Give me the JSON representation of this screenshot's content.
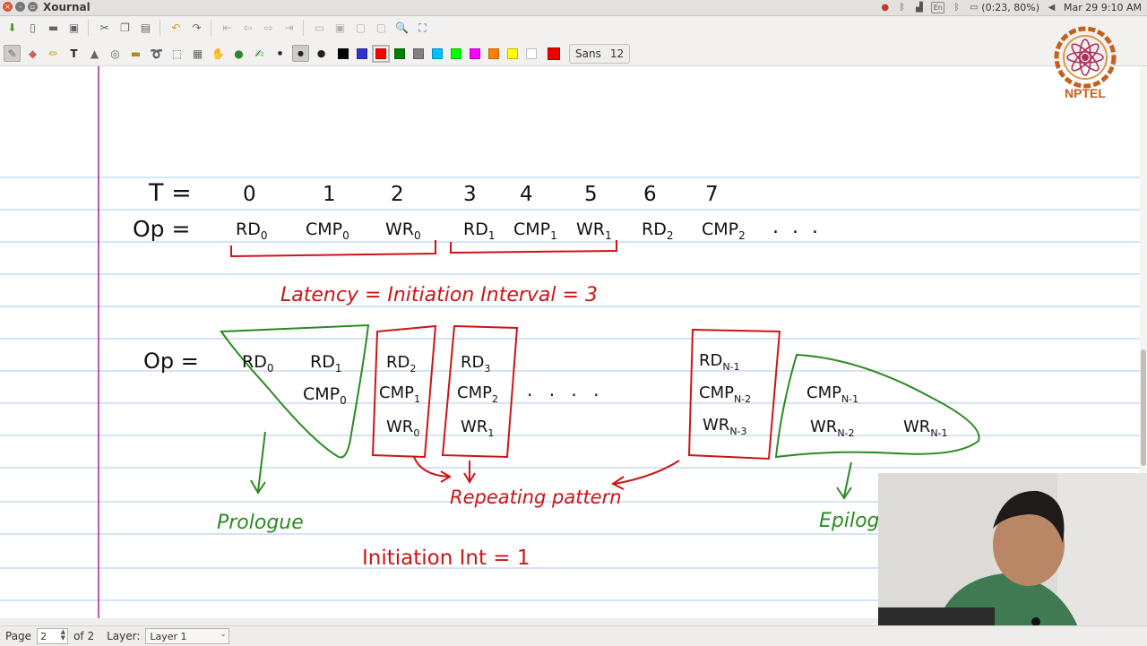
{
  "window": {
    "title": "Xournal",
    "tray": {
      "battery_status": "(0:23, 80%)",
      "datetime": "Mar 29  9:10 AM",
      "keyboard_layout": "En"
    }
  },
  "toolbar": {
    "font_name": "Sans",
    "font_size": "12",
    "colors": [
      "#000000",
      "#3333cc",
      "#ff0000",
      "#008000",
      "#808080",
      "#00c0ff",
      "#00ff00",
      "#ff00ff",
      "#ff8000",
      "#ffff00",
      "#ffffff"
    ],
    "current_color": "#ff0000"
  },
  "logo": {
    "text": "NPTEL"
  },
  "canvas": {
    "margin_color": "#a0148c",
    "rule_color": "#a8c8e8",
    "ink": {
      "black": "#111111",
      "red": "#cc1515",
      "green": "#2a8a22"
    },
    "time_label": "T =",
    "time_values": [
      "0",
      "1",
      "2",
      "3",
      "4",
      "5",
      "6",
      "7"
    ],
    "op_label": "Op =",
    "sequence": [
      {
        "base": "RD",
        "sub": "0"
      },
      {
        "base": "CMP",
        "sub": "0"
      },
      {
        "base": "WR",
        "sub": "0"
      },
      {
        "base": "RD",
        "sub": "1"
      },
      {
        "base": "CMP",
        "sub": "1"
      },
      {
        "base": "WR",
        "sub": "1"
      },
      {
        "base": "RD",
        "sub": "2"
      },
      {
        "base": "CMP",
        "sub": "2"
      }
    ],
    "ellipsis": ". . .",
    "latency_note": "Latency = Initiation Interval = 3",
    "pipeline_label": "Op =",
    "prologue_cells": [
      {
        "base": "RD",
        "sub": "0"
      },
      {
        "base": "RD",
        "sub": "1"
      },
      {
        "base": "CMP",
        "sub": "0"
      }
    ],
    "repeat_box_1": [
      {
        "base": "RD",
        "sub": "2"
      },
      {
        "base": "CMP",
        "sub": "1"
      },
      {
        "base": "WR",
        "sub": "0"
      }
    ],
    "repeat_box_2": [
      {
        "base": "RD",
        "sub": "3"
      },
      {
        "base": "CMP",
        "sub": "2"
      },
      {
        "base": "WR",
        "sub": "1"
      }
    ],
    "dots_middle": ".   .   .   .",
    "repeat_box_last": [
      {
        "base": "RD",
        "sub": "N-1"
      },
      {
        "base": "CMP",
        "sub": "N-2"
      },
      {
        "base": "WR",
        "sub": "N-3"
      }
    ],
    "epilogue_cells": [
      {
        "base": "CMP",
        "sub": "N-1"
      },
      {
        "base": "WR",
        "sub": "N-2"
      },
      {
        "base": "WR",
        "sub": "N-1"
      }
    ],
    "prologue_label": "Prologue",
    "repeating_label": "Repeating pattern",
    "epilogue_label": "Epilog",
    "initiation_int_note": "Initiation Int = 1"
  },
  "statusbar": {
    "page_label": "Page",
    "page_value": "2",
    "page_total": "of 2",
    "layer_label": "Layer:",
    "layer_value": "Layer 1"
  }
}
